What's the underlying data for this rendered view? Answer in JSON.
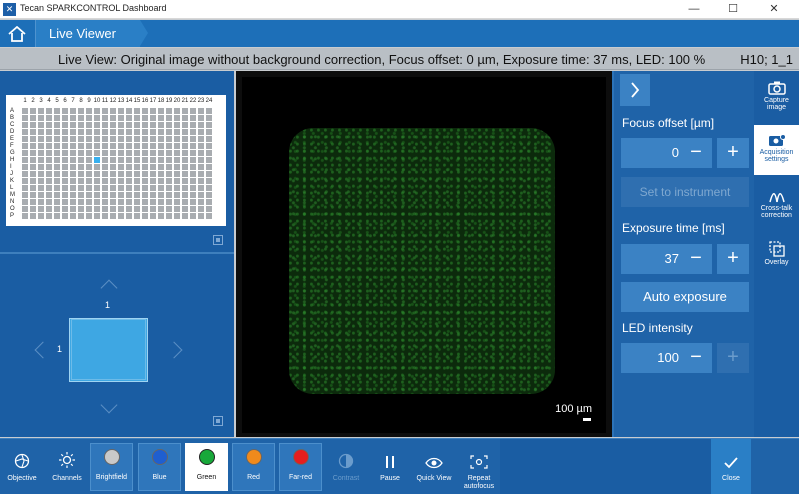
{
  "window": {
    "title": "Tecan SPARKCONTROL Dashboard",
    "minimize": "—",
    "maximize": "☐",
    "close": "✕"
  },
  "breadcrumb": {
    "current": "Live Viewer"
  },
  "status": {
    "message": "Live View: Original image without background correction, Focus offset: 0 µm, Exposure time: 37 ms, LED: 100 %",
    "well_position": "H10; 1_1"
  },
  "plate": {
    "columns": [
      "1",
      "2",
      "3",
      "4",
      "5",
      "6",
      "7",
      "8",
      "9",
      "10",
      "11",
      "12",
      "13",
      "14",
      "15",
      "16",
      "17",
      "18",
      "19",
      "20",
      "21",
      "22",
      "23",
      "24"
    ],
    "rows": [
      "A",
      "B",
      "C",
      "D",
      "E",
      "F",
      "G",
      "H",
      "I",
      "J",
      "K",
      "L",
      "M",
      "N",
      "O",
      "P"
    ],
    "selected_row": "H",
    "selected_col": "10"
  },
  "field_nav": {
    "top_label": "1",
    "left_label": "1"
  },
  "viewer": {
    "scale_label": "100 µm"
  },
  "settings": {
    "focus_label": "Focus offset [µm]",
    "focus_value": "0",
    "set_instrument_label": "Set to instrument",
    "exposure_label": "Exposure time [ms]",
    "exposure_value": "37",
    "auto_exposure_label": "Auto exposure",
    "led_label": "LED intensity",
    "led_value": "100",
    "minus": "−",
    "plus": "+"
  },
  "tools": {
    "capture": "Capture image",
    "acquisition": "Acquisition settings",
    "crosstalk": "Cross-talk correction",
    "overlay": "Overlay"
  },
  "bottom": {
    "objective": "Objective",
    "channels": "Channels",
    "brightfield": "Brightfield",
    "blue": "Blue",
    "green": "Green",
    "red": "Red",
    "farred": "Far-red",
    "contrast": "Contrast",
    "pause": "Pause",
    "quickview": "Quick View",
    "repeat_autofocus": "Repeat autofocus",
    "close": "Close"
  },
  "colors": {
    "header_blue": "#1d6fb8",
    "panel_blue": "#1a5da3",
    "button_blue": "#3b82c4",
    "selected_well": "#38b0ef",
    "brightfield": "#c9c9c9",
    "blue": "#1f5fd0",
    "green": "#18a83a",
    "red": "#f08a1c",
    "farred": "#e51e1e"
  }
}
